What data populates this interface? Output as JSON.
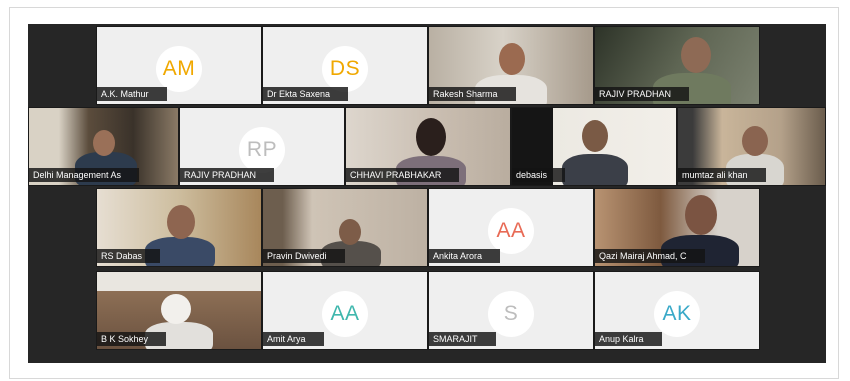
{
  "participants": [
    {
      "name": "A.K. Mathur",
      "initials": "AM",
      "avatar_color": "#f0a800",
      "video": false
    },
    {
      "name": "Dr Ekta Saxena",
      "initials": "DS",
      "avatar_color": "#f0a800",
      "video": false
    },
    {
      "name": "Rakesh Sharma",
      "initials": "",
      "avatar_color": "",
      "video": true
    },
    {
      "name": "RAJIV PRADHAN",
      "initials": "",
      "avatar_color": "",
      "video": true
    },
    {
      "name": "Delhi Management As",
      "initials": "",
      "avatar_color": "",
      "video": true
    },
    {
      "name": "RAJIV PRADHAN",
      "initials": "RP",
      "avatar_color": "#bdbdbd",
      "video": false
    },
    {
      "name": "CHHAVI PRABHAKAR",
      "initials": "",
      "avatar_color": "",
      "video": true
    },
    {
      "name": "debasis",
      "initials": "",
      "avatar_color": "",
      "video": true
    },
    {
      "name": "mumtaz ali khan",
      "initials": "",
      "avatar_color": "",
      "video": true
    },
    {
      "name": "RS Dabas",
      "initials": "",
      "avatar_color": "",
      "video": true
    },
    {
      "name": "Pravin Dwivedi",
      "initials": "",
      "avatar_color": "",
      "video": true
    },
    {
      "name": "Ankita Arora",
      "initials": "AA",
      "avatar_color": "#e86a55",
      "video": false
    },
    {
      "name": "Qazi Mairaj Ahmad, C",
      "initials": "",
      "avatar_color": "",
      "video": true
    },
    {
      "name": "B K Sokhey",
      "initials": "",
      "avatar_color": "",
      "video": true
    },
    {
      "name": "Amit Arya",
      "initials": "AA",
      "avatar_color": "#3fb7ad",
      "video": false
    },
    {
      "name": "SMARAJIT",
      "initials": "S",
      "avatar_color": "#bdbdbd",
      "video": false
    },
    {
      "name": "Anup Kalra",
      "initials": "AK",
      "avatar_color": "#3aa9c8",
      "video": false
    }
  ]
}
